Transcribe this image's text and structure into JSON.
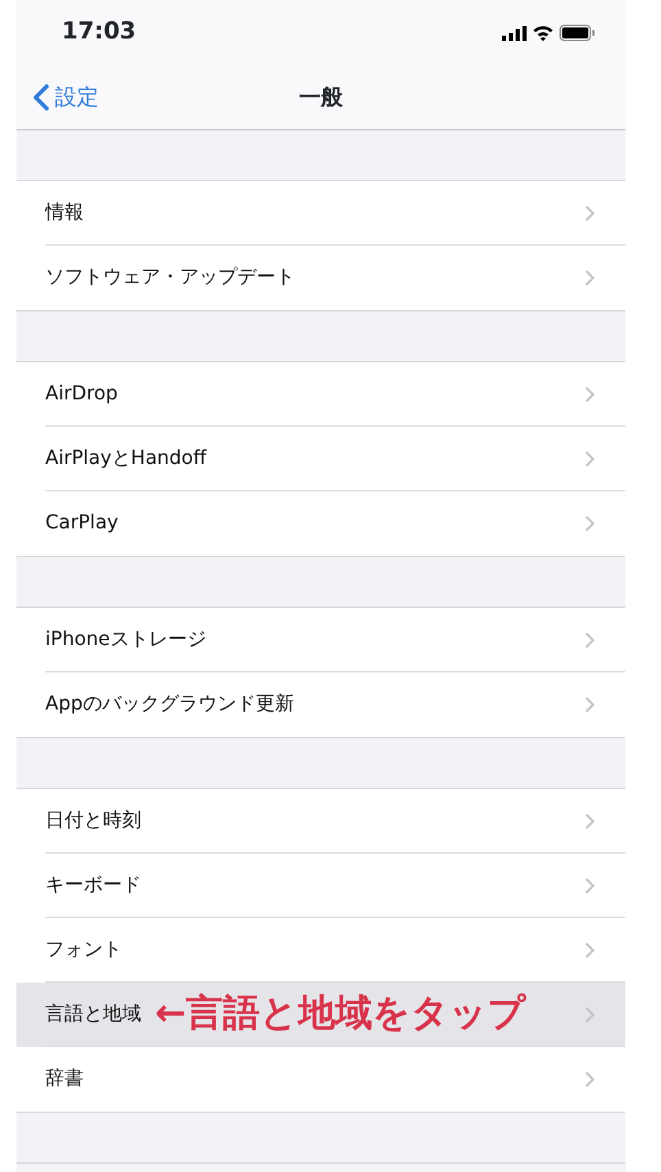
{
  "status_bar": {
    "time": "17:03"
  },
  "nav": {
    "back": "設定",
    "title": "一般"
  },
  "groups": [
    {
      "items": [
        {
          "label": "情報",
          "selected": false
        },
        {
          "label": "ソフトウェア・アップデート",
          "selected": false
        }
      ]
    },
    {
      "items": [
        {
          "label": "AirDrop",
          "selected": false
        },
        {
          "label": "AirPlayとHandoff",
          "selected": false
        },
        {
          "label": "CarPlay",
          "selected": false
        }
      ]
    },
    {
      "items": [
        {
          "label": "iPhoneストレージ",
          "selected": false
        },
        {
          "label": "Appのバックグラウンド更新",
          "selected": false
        }
      ]
    },
    {
      "items": [
        {
          "label": "日付と時刻",
          "selected": false
        },
        {
          "label": "キーボード",
          "selected": false
        },
        {
          "label": "フォント",
          "selected": false
        },
        {
          "label": "言語と地域",
          "selected": true,
          "annotation": "←言語と地域をタップ"
        },
        {
          "label": "辞書",
          "selected": false
        }
      ]
    }
  ]
}
